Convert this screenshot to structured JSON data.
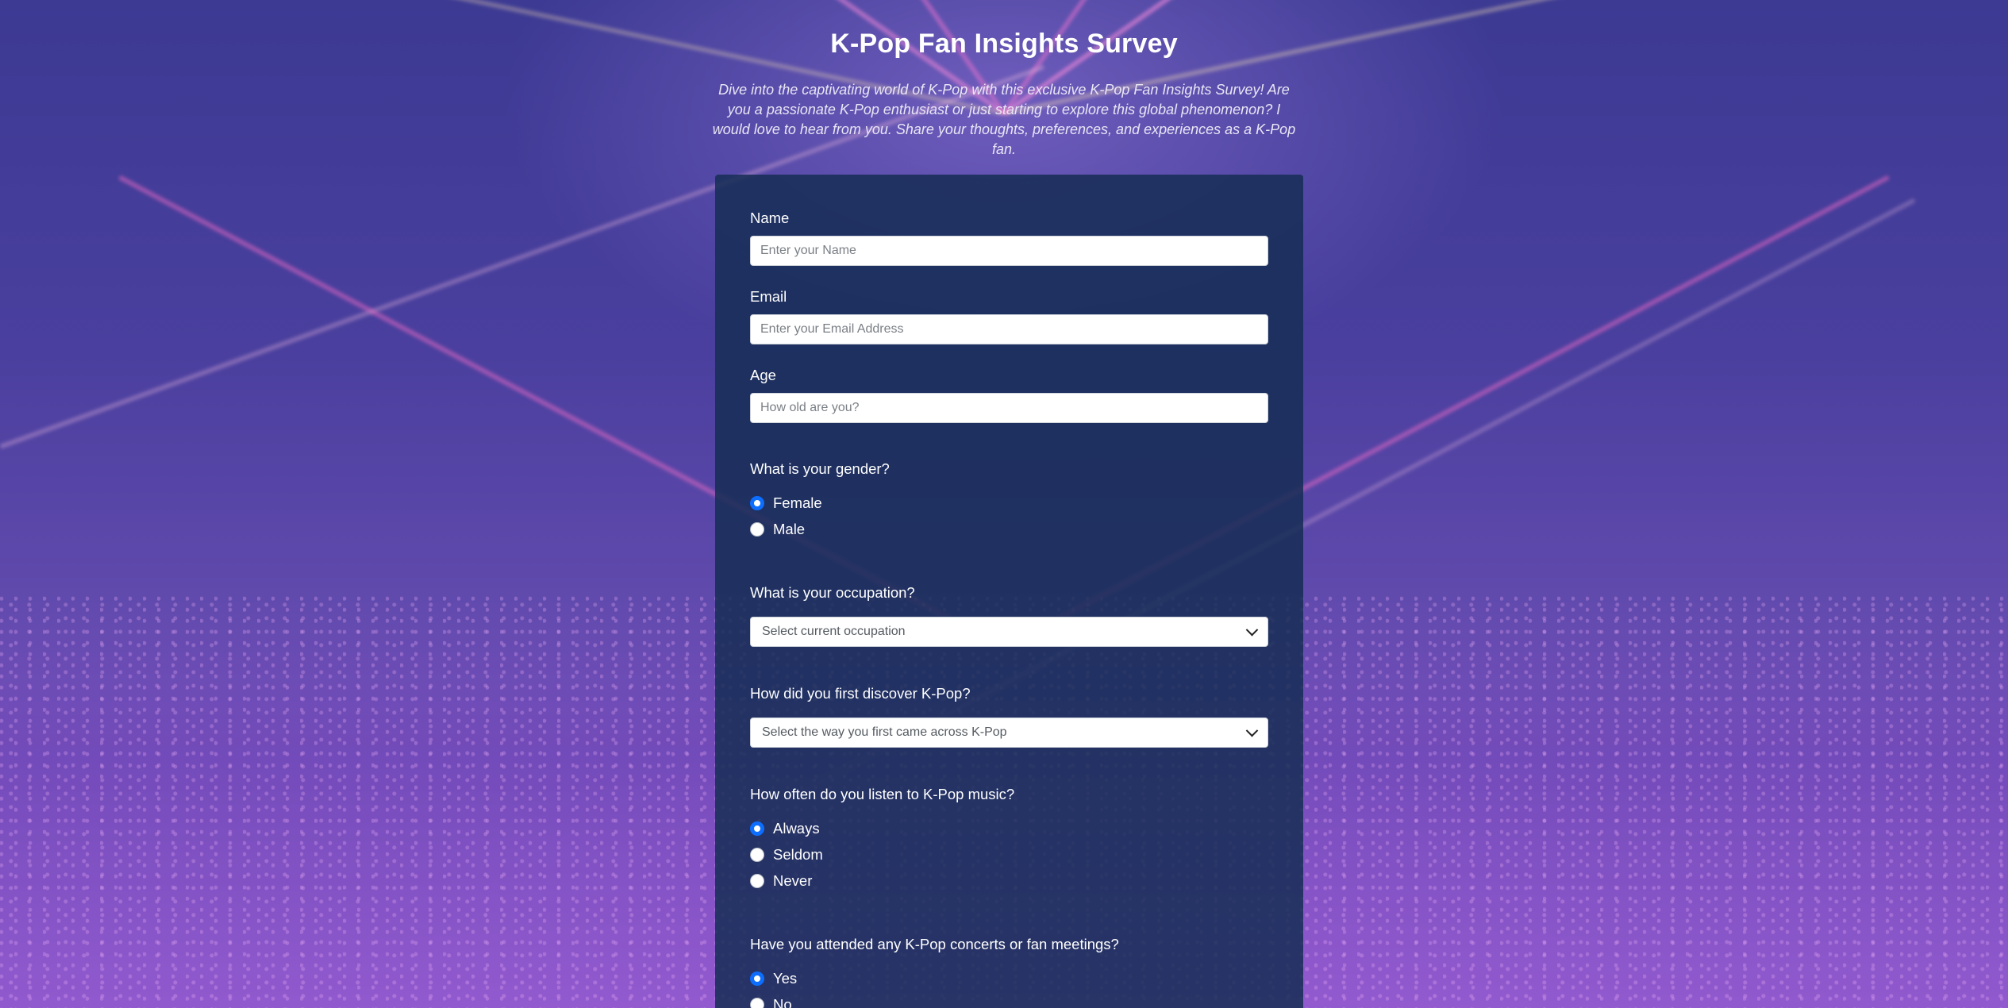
{
  "page": {
    "title": "K-Pop Fan Insights Survey",
    "description": "Dive into the captivating world of K-Pop with this exclusive K-Pop Fan Insights Survey! Are you a passionate K-Pop enthusiast or just starting to explore this global phenomenon? I would love to hear from you. Share your thoughts, preferences, and experiences as a K-Pop fan."
  },
  "form": {
    "name": {
      "label": "Name",
      "placeholder": "Enter your Name",
      "value": ""
    },
    "email": {
      "label": "Email",
      "placeholder": "Enter your Email Address",
      "value": ""
    },
    "age": {
      "label": "Age",
      "placeholder": "How old are you?",
      "value": ""
    },
    "gender": {
      "question": "What is your gender?",
      "options": [
        {
          "label": "Female",
          "selected": true
        },
        {
          "label": "Male",
          "selected": false
        }
      ]
    },
    "occupation": {
      "question": "What is your occupation?",
      "selected": "Select current occupation"
    },
    "discovery": {
      "question": "How did you first discover K-Pop?",
      "selected": "Select the way you first came across K-Pop"
    },
    "listening": {
      "question": "How often do you listen to K-Pop music?",
      "options": [
        {
          "label": "Always",
          "selected": true
        },
        {
          "label": "Seldom",
          "selected": false
        },
        {
          "label": "Never",
          "selected": false
        }
      ]
    },
    "concerts": {
      "question": "Have you attended any K-Pop concerts or fan meetings?",
      "options": [
        {
          "label": "Yes",
          "selected": true
        },
        {
          "label": "No",
          "selected": false
        }
      ]
    }
  },
  "colors": {
    "card_background": "#162d55",
    "radio_accent": "#0d6efd",
    "page_background": "#4a3f9a"
  }
}
